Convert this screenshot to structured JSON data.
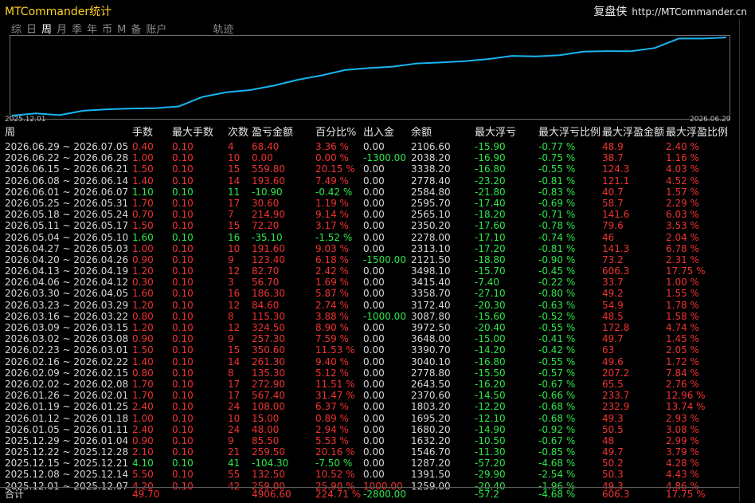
{
  "app": {
    "title": "MTCommander统计",
    "brand_cn": "复盘侠",
    "brand_url": "http://MTCommander.cn"
  },
  "tabs": [
    {
      "label": "综",
      "active": false
    },
    {
      "label": "日",
      "active": false
    },
    {
      "label": "周",
      "active": true
    },
    {
      "label": "月",
      "active": false
    },
    {
      "label": "季",
      "active": false
    },
    {
      "label": "年",
      "active": false
    },
    {
      "label": "币",
      "active": false
    },
    {
      "label": "M",
      "active": false
    },
    {
      "label": "备",
      "active": false
    },
    {
      "label": "账户",
      "active": false
    }
  ],
  "track_tab": "轨迹",
  "chart_data": {
    "type": "line",
    "x_start": "2025.12.01",
    "x_end": "2026.06.29",
    "x": [
      "2025.12.01",
      "2025.12.08",
      "2025.12.15",
      "2025.12.22",
      "2025.12.29",
      "2026.01.05",
      "2026.01.12",
      "2026.01.19",
      "2026.01.26",
      "2026.02.02",
      "2026.02.09",
      "2026.02.16",
      "2026.02.23",
      "2026.03.02",
      "2026.03.09",
      "2026.03.16",
      "2026.03.23",
      "2026.03.30",
      "2026.04.06",
      "2026.04.13",
      "2026.04.20",
      "2026.04.27",
      "2026.05.04",
      "2026.05.11",
      "2026.05.18",
      "2026.05.25",
      "2026.06.01",
      "2026.06.08",
      "2026.06.15",
      "2026.06.22",
      "2026.06.29"
    ],
    "values": [
      1259.0,
      1391.5,
      1287.2,
      1546.7,
      1632.2,
      1680.2,
      1695.2,
      1803.2,
      2370.6,
      2643.5,
      2778.8,
      3040.1,
      3390.7,
      3648.0,
      3972.5,
      4087.8,
      4172.4,
      4358.7,
      4415.4,
      4498.1,
      4621.5,
      4813.1,
      4778.0,
      4850.2,
      5065.1,
      5095.7,
      5084.8,
      5278.4,
      5838.2,
      5838.2,
      5906.6
    ]
  },
  "columns": [
    "周",
    "手数",
    "最大手数",
    "次数",
    "盈亏金额",
    "百分比%",
    "出入金",
    "余额",
    "最大浮亏",
    "最大浮亏比例",
    "最大浮盈金额",
    "最大浮盈比例"
  ],
  "rows": [
    [
      "2026.06.29 ~ 2026.07.05",
      "0.40",
      "0.10",
      "4",
      "68.40",
      "3.36 %",
      "0.00",
      "2106.60",
      "-15.90",
      "-0.77 %",
      "48.9",
      "2.40 %"
    ],
    [
      "2026.06.22 ~ 2026.06.28",
      "1.00",
      "0.10",
      "10",
      "0.00",
      "0.00 %",
      "-1300.00",
      "2038.20",
      "-16.90",
      "-0.75 %",
      "38.7",
      "1.16 %"
    ],
    [
      "2026.06.15 ~ 2026.06.21",
      "1.50",
      "0.10",
      "15",
      "559.80",
      "20.15 %",
      "0.00",
      "3338.20",
      "-16.80",
      "-0.55 %",
      "124.3",
      "4.03 %"
    ],
    [
      "2026.06.08 ~ 2026.06.14",
      "1.40",
      "0.10",
      "14",
      "193.60",
      "7.49 %",
      "0.00",
      "2778.40",
      "-23.20",
      "-0.81 %",
      "121.1",
      "4.52 %"
    ],
    [
      "2026.06.01 ~ 2026.06.07",
      "1.10",
      "0.10",
      "11",
      "-10.90",
      "-0.42 %",
      "0.00",
      "2584.80",
      "-21.80",
      "-0.83 %",
      "40.7",
      "1.57 %"
    ],
    [
      "2026.05.25 ~ 2026.05.31",
      "1.70",
      "0.10",
      "17",
      "30.60",
      "1.19 %",
      "0.00",
      "2595.70",
      "-17.40",
      "-0.69 %",
      "58.7",
      "2.29 %"
    ],
    [
      "2026.05.18 ~ 2026.05.24",
      "0.70",
      "0.10",
      "7",
      "214.90",
      "9.14 %",
      "0.00",
      "2565.10",
      "-18.20",
      "-0.71 %",
      "141.6",
      "6.03 %"
    ],
    [
      "2026.05.11 ~ 2026.05.17",
      "1.50",
      "0.10",
      "15",
      "72.20",
      "3.17 %",
      "0.00",
      "2350.20",
      "-17.60",
      "-0.78 %",
      "79.6",
      "3.53 %"
    ],
    [
      "2026.05.04 ~ 2026.05.10",
      "1.60",
      "0.10",
      "16",
      "-35.10",
      "-1.52 %",
      "0.00",
      "2278.00",
      "-17.10",
      "-0.74 %",
      "46",
      "2.04 %"
    ],
    [
      "2026.04.27 ~ 2026.05.03",
      "1.00",
      "0.10",
      "10",
      "191.60",
      "9.03 %",
      "0.00",
      "2313.10",
      "-17.20",
      "-0.81 %",
      "141.3",
      "6.78 %"
    ],
    [
      "2026.04.20 ~ 2026.04.26",
      "0.90",
      "0.10",
      "9",
      "123.40",
      "6.18 %",
      "-1500.00",
      "2121.50",
      "-18.80",
      "-0.90 %",
      "73.2",
      "2.31 %"
    ],
    [
      "2026.04.13 ~ 2026.04.19",
      "1.20",
      "0.10",
      "12",
      "82.70",
      "2.42 %",
      "0.00",
      "3498.10",
      "-15.70",
      "-0.45 %",
      "606.3",
      "17.75 %"
    ],
    [
      "2026.04.06 ~ 2026.04.12",
      "0.30",
      "0.10",
      "3",
      "56.70",
      "1.69 %",
      "0.00",
      "3415.40",
      "-7.40",
      "-0.22 %",
      "33.7",
      "1.00 %"
    ],
    [
      "2026.03.30 ~ 2026.04.05",
      "1.60",
      "0.10",
      "16",
      "186.30",
      "5.87 %",
      "0.00",
      "3358.70",
      "-27.10",
      "-0.80 %",
      "49.2",
      "1.55 %"
    ],
    [
      "2026.03.23 ~ 2026.03.29",
      "1.20",
      "0.10",
      "12",
      "84.60",
      "2.74 %",
      "0.00",
      "3172.40",
      "-20.30",
      "-0.63 %",
      "54.9",
      "1.78 %"
    ],
    [
      "2026.03.16 ~ 2026.03.22",
      "0.80",
      "0.10",
      "8",
      "115.30",
      "3.88 %",
      "-1000.00",
      "3087.80",
      "-15.60",
      "-0.52 %",
      "48.5",
      "1.58 %"
    ],
    [
      "2026.03.09 ~ 2026.03.15",
      "1.20",
      "0.10",
      "12",
      "324.50",
      "8.90 %",
      "0.00",
      "3972.50",
      "-20.40",
      "-0.55 %",
      "172.8",
      "4.74 %"
    ],
    [
      "2026.03.02 ~ 2026.03.08",
      "0.90",
      "0.10",
      "9",
      "257.30",
      "7.59 %",
      "0.00",
      "3648.00",
      "-15.00",
      "-0.41 %",
      "49.7",
      "1.45 %"
    ],
    [
      "2026.02.23 ~ 2026.03.01",
      "1.50",
      "0.10",
      "15",
      "350.60",
      "11.53 %",
      "0.00",
      "3390.70",
      "-14.20",
      "-0.42 %",
      "63",
      "2.05 %"
    ],
    [
      "2026.02.16 ~ 2026.02.22",
      "1.40",
      "0.10",
      "14",
      "261.30",
      "9.40 %",
      "0.00",
      "3040.10",
      "-16.80",
      "-0.55 %",
      "49.6",
      "1.72 %"
    ],
    [
      "2026.02.09 ~ 2026.02.15",
      "0.80",
      "0.10",
      "8",
      "135.30",
      "5.12 %",
      "0.00",
      "2778.80",
      "-15.50",
      "-0.57 %",
      "207.2",
      "7.84 %"
    ],
    [
      "2026.02.02 ~ 2026.02.08",
      "1.70",
      "0.10",
      "17",
      "272.90",
      "11.51 %",
      "0.00",
      "2643.50",
      "-16.20",
      "-0.67 %",
      "65.5",
      "2.76 %"
    ],
    [
      "2026.01.26 ~ 2026.02.01",
      "1.70",
      "0.10",
      "17",
      "567.40",
      "31.47 %",
      "0.00",
      "2370.60",
      "-14.50",
      "-0.66 %",
      "233.7",
      "12.96 %"
    ],
    [
      "2026.01.19 ~ 2026.01.25",
      "2.40",
      "0.10",
      "24",
      "108.00",
      "6.37 %",
      "0.00",
      "1803.20",
      "-12.20",
      "-0.68 %",
      "232.9",
      "13.74 %"
    ],
    [
      "2026.01.12 ~ 2026.01.18",
      "1.00",
      "0.10",
      "10",
      "15.00",
      "0.89 %",
      "0.00",
      "1695.20",
      "-12.10",
      "-0.68 %",
      "49.3",
      "2.93 %"
    ],
    [
      "2026.01.05 ~ 2026.01.11",
      "2.40",
      "0.10",
      "24",
      "48.00",
      "2.94 %",
      "0.00",
      "1680.20",
      "-14.90",
      "-0.92 %",
      "50.5",
      "3.08 %"
    ],
    [
      "2025.12.29 ~ 2026.01.04",
      "0.90",
      "0.10",
      "9",
      "85.50",
      "5.53 %",
      "0.00",
      "1632.20",
      "-10.50",
      "-0.67 %",
      "48",
      "2.99 %"
    ],
    [
      "2025.12.22 ~ 2025.12.28",
      "2.10",
      "0.10",
      "21",
      "259.50",
      "20.16 %",
      "0.00",
      "1546.70",
      "-11.30",
      "-0.85 %",
      "49.7",
      "3.79 %"
    ],
    [
      "2025.12.15 ~ 2025.12.21",
      "4.10",
      "0.10",
      "41",
      "-104.30",
      "-7.50 %",
      "0.00",
      "1287.20",
      "-57.20",
      "-4.68 %",
      "50.2",
      "4.28 %"
    ],
    [
      "2025.12.08 ~ 2025.12.14",
      "5.50",
      "0.10",
      "55",
      "132.50",
      "10.52 %",
      "0.00",
      "1391.50",
      "-29.90",
      "-2.54 %",
      "50.3",
      "4.43 %"
    ],
    [
      "2025.12.01 ~ 2025.12.07",
      "4.20",
      "0.10",
      "42",
      "259.00",
      "25.90 %",
      "1000.00",
      "1259.00",
      "-20.40",
      "-1.96 %",
      "49.3",
      "4.86 %"
    ]
  ],
  "total": {
    "label": "合计",
    "lots": "49.70",
    "pnl": "4906.60",
    "pct": "224.71 %",
    "flow": "-2800.00",
    "max_float_loss": "-57.2",
    "max_float_loss_pct": "-4.68 %",
    "max_float_profit": "606.3",
    "max_float_profit_pct": "17.75 %"
  },
  "colors": {
    "up": "#f03232",
    "down": "#2ee64a",
    "line": "#19b4f0",
    "title": "#ffd21f"
  }
}
